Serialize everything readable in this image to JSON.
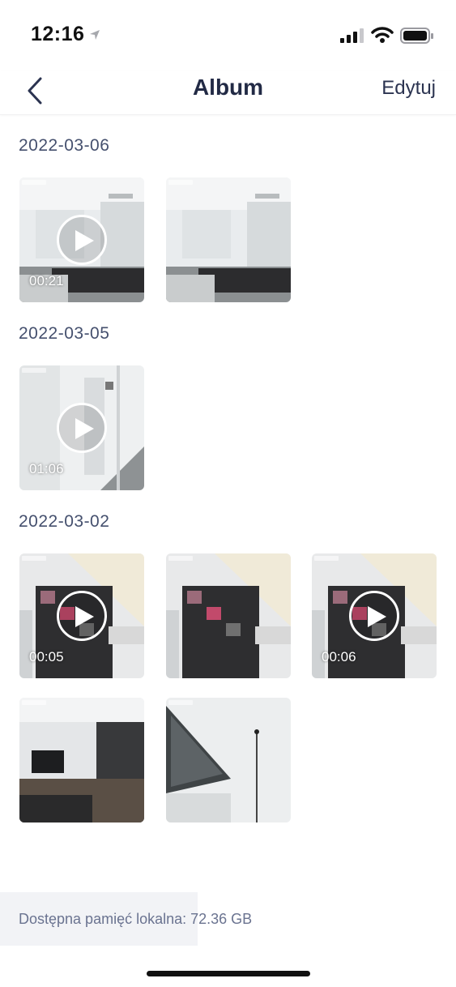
{
  "status_bar": {
    "time": "12:16"
  },
  "nav": {
    "title": "Album",
    "edit_label": "Edytuj"
  },
  "sections": [
    {
      "date": "2022-03-06",
      "items": [
        {
          "duration": "00:21"
        },
        {
          "duration": ""
        }
      ]
    },
    {
      "date": "2022-03-05",
      "items": [
        {
          "duration": "01:06"
        }
      ]
    },
    {
      "date": "2022-03-02",
      "items": [
        {
          "duration": "00:05"
        },
        {
          "duration": ""
        },
        {
          "duration": "00:06"
        },
        {
          "duration": ""
        },
        {
          "duration": ""
        }
      ]
    }
  ],
  "footer": {
    "storage_text": "Dostępna pamięć lokalna: 72.36 GB"
  },
  "colors": {
    "title": "#222a45",
    "date_text": "#45506e",
    "storage_bg": "#f2f3f6",
    "storage_text": "#6a7390"
  },
  "icons": [
    "location-arrow-icon",
    "signal-icon",
    "wifi-icon",
    "battery-icon",
    "chevron-left-icon",
    "play-icon"
  ]
}
